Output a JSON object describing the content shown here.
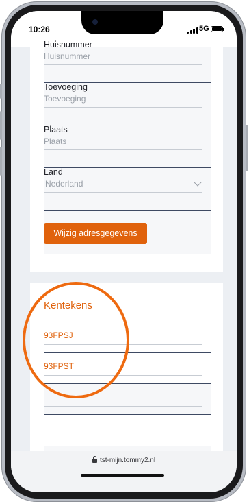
{
  "status": {
    "time": "10:26",
    "network": "5G"
  },
  "address": {
    "fields": [
      {
        "label": "Huisnummer",
        "placeholder": "Huisnummer"
      },
      {
        "label": "Toevoeging",
        "placeholder": "Toevoeging"
      },
      {
        "label": "Plaats",
        "placeholder": "Plaats"
      }
    ],
    "country": {
      "label": "Land",
      "value": "Nederland"
    },
    "button_label": "Wijzig adresgegevens"
  },
  "plates": {
    "title": "Kentekens",
    "items": [
      "93FPSJ",
      "93FPST",
      "",
      ""
    ]
  },
  "browser": {
    "url": "tst-mijn.tommy2.nl"
  },
  "colors": {
    "accent": "#e0620c",
    "divider": "#3e4a63",
    "highlight_circle": "#ee6a10"
  }
}
